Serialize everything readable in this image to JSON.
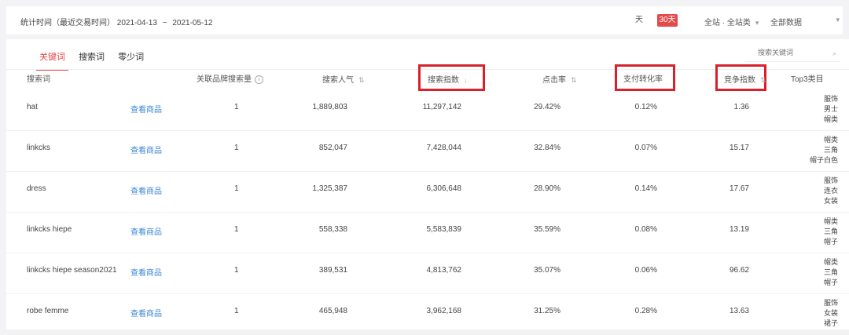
{
  "topbar": {
    "period_label": "统计时间（最近交易时间）",
    "date_from": "2021-04-13",
    "date_to": "2021-05-12",
    "range_day": "天",
    "range_week": "30天",
    "select_1": "全站 · 全站类",
    "select_2": "全部数据"
  },
  "tabs": [
    "关键词",
    "搜索词",
    "零少词"
  ],
  "search": {
    "placeholder": "搜索关键词"
  },
  "columns": {
    "keyword": "搜索词",
    "related": "关联品牌搜索量",
    "search_pop": "搜索人气",
    "search_index": "搜索指数",
    "click_rate": "点击率",
    "pay_rate": "支付转化率",
    "compete": "竞争指数",
    "top3": "Top3类目"
  },
  "colors": {
    "accent": "#e34a4a",
    "highlight_box": "#d8212b",
    "link": "#3b86d6"
  },
  "rows": [
    {
      "keyword": "hat",
      "link": "查看商品",
      "related": "1",
      "search_pop": "1,889,803",
      "search_index": "11,297,142",
      "click_rate": "29.42%",
      "pay_rate": "0.12%",
      "compete": "1.36",
      "tags": [
        "服饰",
        "男士",
        "帽类"
      ]
    },
    {
      "keyword": "linkcks",
      "link": "查看商品",
      "related": "1",
      "search_pop": "852,047",
      "search_index": "7,428,044",
      "click_rate": "32.84%",
      "pay_rate": "0.07%",
      "compete": "15.17",
      "tags": [
        "帽类",
        "三角",
        "帽子白色"
      ]
    },
    {
      "keyword": "dress",
      "link": "查看商品",
      "related": "1",
      "search_pop": "1,325,387",
      "search_index": "6,306,648",
      "click_rate": "28.90%",
      "pay_rate": "0.14%",
      "compete": "17.67",
      "tags": [
        "服饰",
        "连衣",
        "女装"
      ]
    },
    {
      "keyword": "linkcks hiepe",
      "link": "查看商品",
      "related": "1",
      "search_pop": "558,338",
      "search_index": "5,583,839",
      "click_rate": "35.59%",
      "pay_rate": "0.08%",
      "compete": "13.19",
      "tags": [
        "帽类",
        "三角",
        "帽子"
      ]
    },
    {
      "keyword": "linkcks hiepe season2021",
      "link": "查看商品",
      "related": "1",
      "search_pop": "389,531",
      "search_index": "4,813,762",
      "click_rate": "35.07%",
      "pay_rate": "0.06%",
      "compete": "96.62",
      "tags": [
        "帽类",
        "三角",
        "帽子"
      ]
    },
    {
      "keyword": "robe femme",
      "link": "查看商品",
      "related": "1",
      "search_pop": "465,948",
      "search_index": "3,962,168",
      "click_rate": "31.25%",
      "pay_rate": "0.28%",
      "compete": "13.63",
      "tags": [
        "服饰",
        "女装",
        "裙子"
      ]
    }
  ]
}
